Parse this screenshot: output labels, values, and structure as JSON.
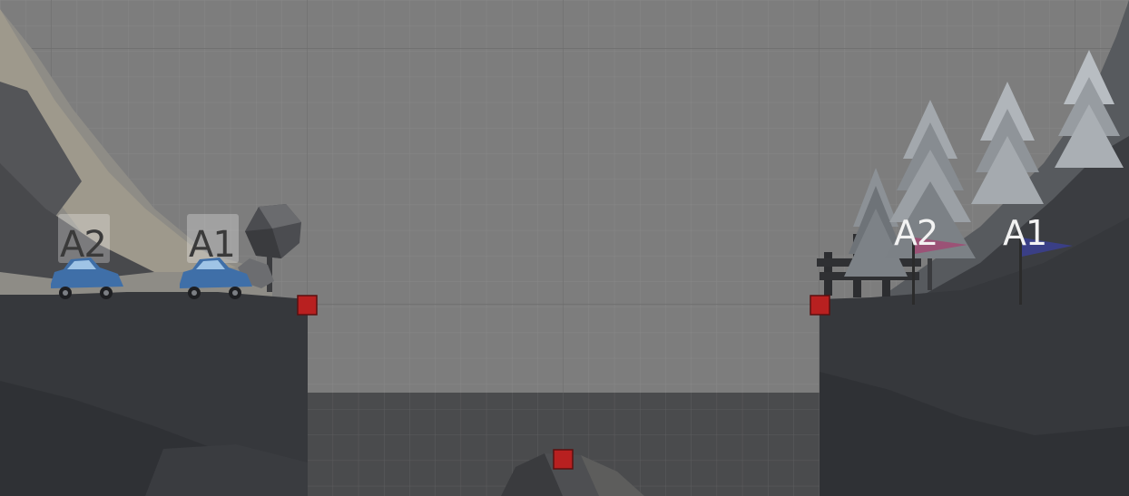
{
  "scene": {
    "background_color": "#7d7d7d",
    "terrain_color": "#35373b",
    "anchor_color": "#b82020",
    "car_color": "#3f6fa8"
  },
  "cars": [
    {
      "label": "A2",
      "color": "#3f6fa8"
    },
    {
      "label": "A1",
      "color": "#3f6fa8"
    }
  ],
  "flags": [
    {
      "label": "A2",
      "color": "#a14a73"
    },
    {
      "label": "A1",
      "color": "#3b3f8e"
    }
  ],
  "anchors": [
    {
      "name": "left-cliff-anchor"
    },
    {
      "name": "right-cliff-anchor"
    },
    {
      "name": "center-rock-anchor"
    }
  ]
}
